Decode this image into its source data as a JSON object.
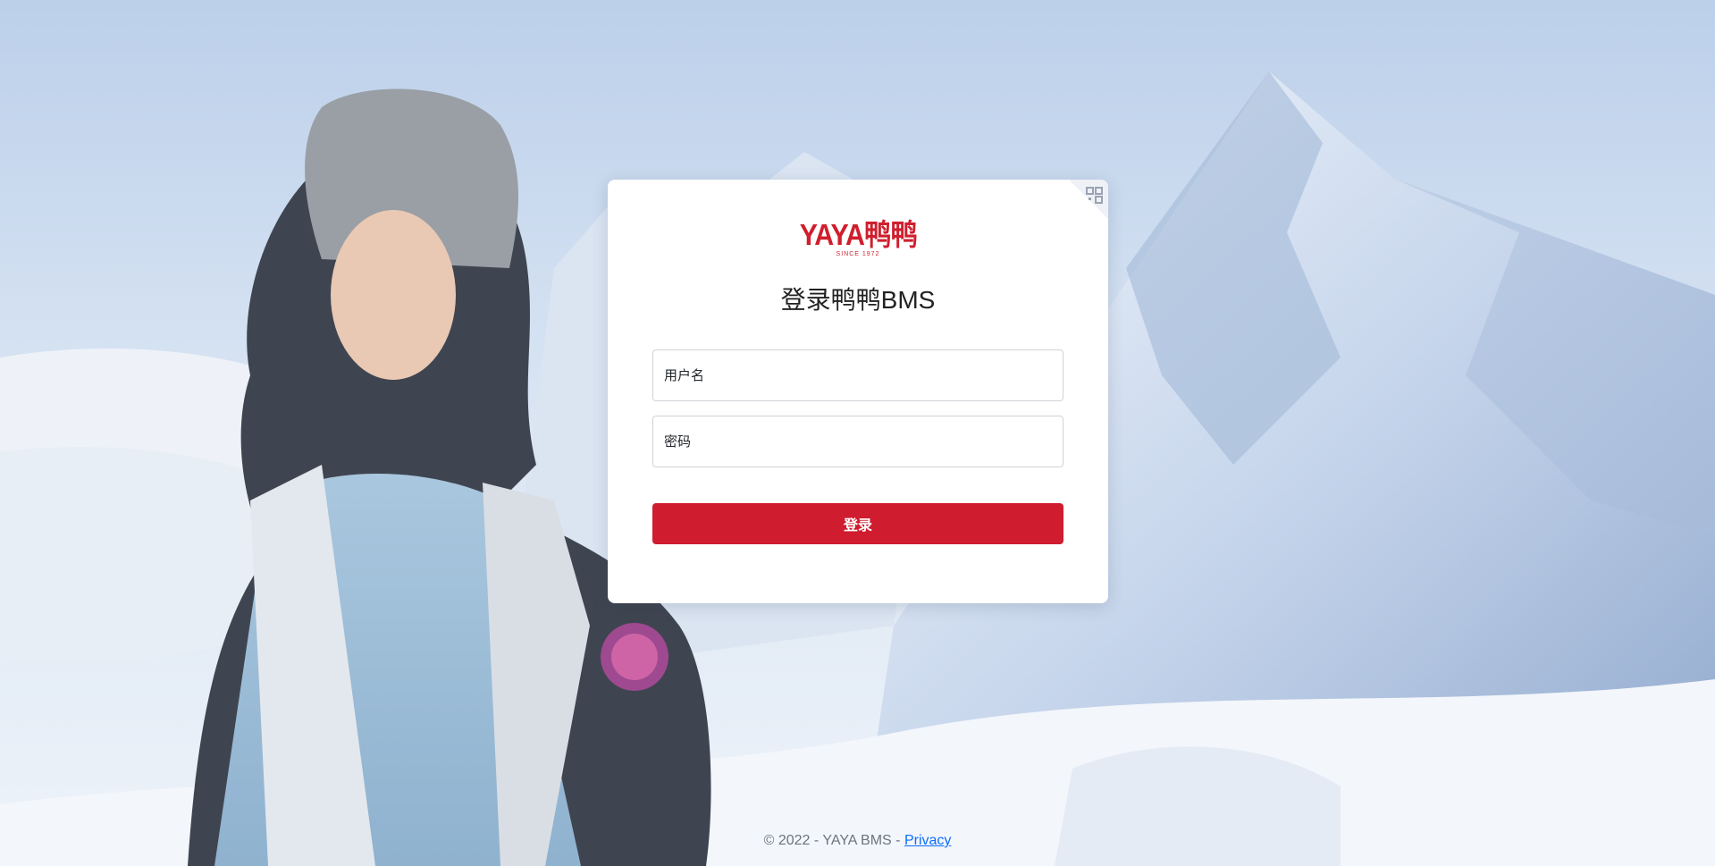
{
  "brand": {
    "logo_text": "YAYA鸭鸭",
    "logo_tagline": "SINCE 1972",
    "accent_color": "#d01c2f"
  },
  "login": {
    "title": "登录鸭鸭BMS",
    "username_placeholder": "用户名",
    "password_placeholder": "密码",
    "submit_label": "登录",
    "qr_icon": "qr-code-icon"
  },
  "footer": {
    "copyright": "© 2022 - YAYA BMS - ",
    "privacy_label": "Privacy",
    "link_color": "#0d6efd"
  }
}
